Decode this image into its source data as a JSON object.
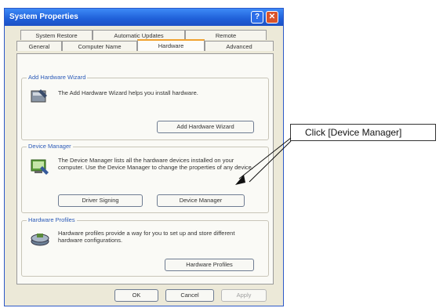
{
  "window": {
    "title": "System Properties",
    "help_glyph": "?",
    "close_glyph": "✕",
    "tabs_row1": [
      "System Restore",
      "Automatic Updates",
      "Remote"
    ],
    "tabs_row2": [
      "General",
      "Computer Name",
      "Hardware",
      "Advanced"
    ],
    "active_tab": "Hardware"
  },
  "add_hardware": {
    "title": "Add Hardware Wizard",
    "text": "The Add Hardware Wizard helps you install hardware.",
    "button": "Add Hardware Wizard",
    "icon": "add-hardware-icon"
  },
  "device_manager": {
    "title": "Device Manager",
    "text": "The Device Manager lists all the hardware devices installed on your computer. Use the Device Manager to change the properties of any device.",
    "signing_button": "Driver Signing",
    "button": "Device Manager",
    "icon": "device-manager-icon"
  },
  "hardware_profiles": {
    "title": "Hardware Profiles",
    "text": "Hardware profiles provide a way for you to set up and store different hardware configurations.",
    "button": "Hardware Profiles",
    "icon": "hardware-profiles-icon"
  },
  "footer": {
    "ok": "OK",
    "cancel": "Cancel",
    "apply": "Apply"
  },
  "annotation": {
    "text": "Click [Device Manager]"
  },
  "colors": {
    "titlebar": "#1f5fd8",
    "close": "#d9532a",
    "dialog_bg": "#ece9d8",
    "tab_accent": "#f0a230"
  }
}
